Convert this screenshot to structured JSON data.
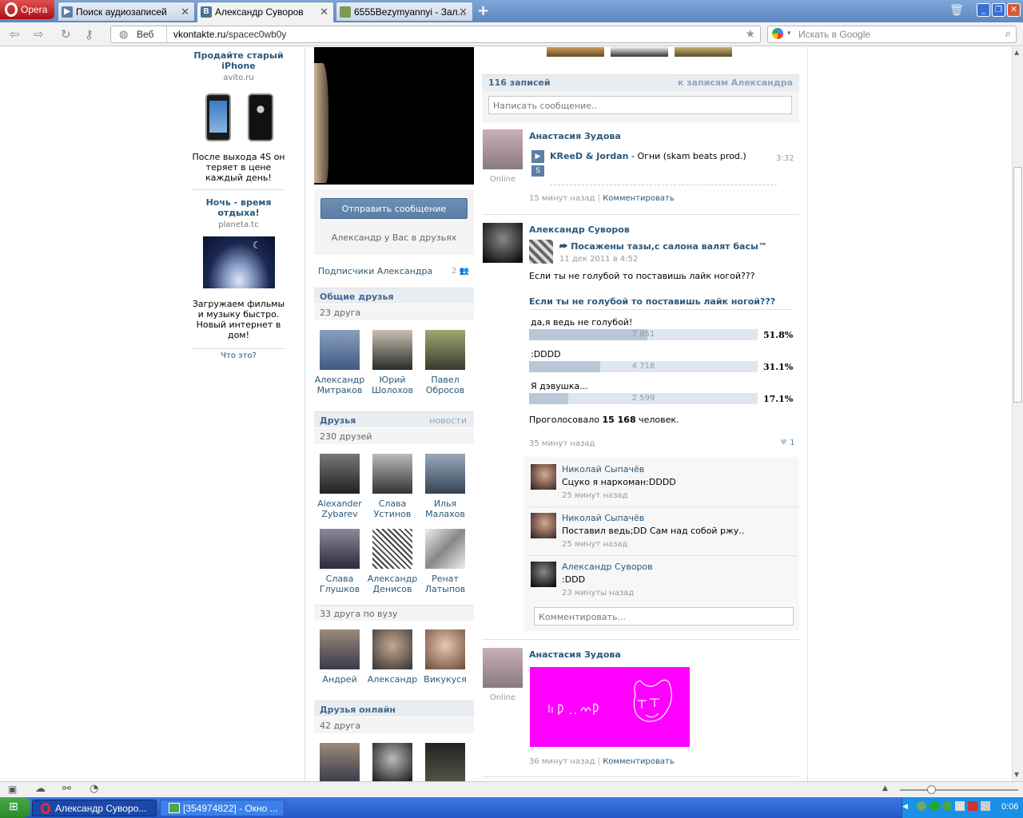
{
  "browser": {
    "menu_label": "Opera",
    "tabs": [
      {
        "label": "Поиск аудиозаписей"
      },
      {
        "label": "Александр Суворов"
      },
      {
        "label": "6555Bezymyannyi - Зал..."
      }
    ],
    "address_mode": "Веб",
    "url_host": "vkontakte.ru",
    "url_path": "/spacec0wb0y",
    "search_placeholder": "Искать в Google"
  },
  "ads": [
    {
      "title": "Продайте старый iPhone",
      "domain": "avito.ru",
      "text": "После выхода 4S он теряет в цене каждый день!"
    },
    {
      "title": "Ночь - время отдыха!",
      "domain": "planeta.tc",
      "text": "Загружаем фильмы и музыку быстро. Новый интернет в дом!"
    }
  ],
  "ads_what": "Что это?",
  "profile": {
    "send_message": "Отправить сообщение",
    "friend_status": "Александр у Вас в друзьях",
    "subscribers_label": "Подписчики Александра",
    "subscribers_count": "2",
    "common_friends": {
      "title": "Общие друзья",
      "count": "23 друга",
      "items": [
        {
          "first": "Александр",
          "last": "Митраков"
        },
        {
          "first": "Юрий",
          "last": "Шолохов"
        },
        {
          "first": "Павел",
          "last": "Обросов"
        }
      ]
    },
    "friends": {
      "title": "Друзья",
      "news": "новости",
      "count": "230 друзей",
      "items": [
        {
          "first": "Alexander",
          "last": "Zybarev"
        },
        {
          "first": "Слава",
          "last": "Устинов"
        },
        {
          "first": "Илья",
          "last": "Малахов"
        },
        {
          "first": "Слава",
          "last": "Глушков"
        },
        {
          "first": "Александр",
          "last": "Денисов"
        },
        {
          "first": "Ренат",
          "last": "Латыпов"
        }
      ]
    },
    "uni_friends": {
      "count": "33 друга по вузу",
      "items": [
        {
          "first": "Андрей",
          "last": ""
        },
        {
          "first": "Александр",
          "last": ""
        },
        {
          "first": "Викукуся",
          "last": ""
        }
      ]
    },
    "online_friends": {
      "title": "Друзья онлайн",
      "count": "42 друга"
    }
  },
  "wall": {
    "count": "116 записей",
    "to_posts": "к записям Александра",
    "input_placeholder": "Написать сообщение..",
    "post1": {
      "author": "Анастасия Зудова",
      "online": "Online",
      "artist": "KReeD & Jordan",
      "title": " - Огни (skam beats prod.)",
      "duration": "3:32",
      "time": "15 минут назад",
      "comment": "Комментировать"
    },
    "post2": {
      "author": "Александр Суворов",
      "repost_title": "Посажены тазы,с салона валят басы™",
      "repost_date": "11 дек 2011 в 4:52",
      "text": "Если ты не голубой то поставишь лайк ногой???",
      "poll_title": "Если ты не голубой то поставишь лайк ногой???",
      "poll": [
        {
          "label": "да,я ведь не голубой!",
          "votes": "7 851",
          "pct": "51.8%",
          "fraction": 0.518
        },
        {
          "label": ":DDDD",
          "votes": "4 718",
          "pct": "31.1%",
          "fraction": 0.311
        },
        {
          "label": "Я дэвушка...",
          "votes": "2 599",
          "pct": "17.1%",
          "fraction": 0.171
        }
      ],
      "voted_prefix": "Проголосовало ",
      "voted_count": "15 168",
      "voted_suffix": " человек.",
      "time": "35 минут назад",
      "likes": "1",
      "replies": [
        {
          "author": "Николай Сыпачёв",
          "text": "Сцуко я наркоман:DDDD",
          "time": "25 минут назад"
        },
        {
          "author": "Николай Сыпачёв",
          "text": "Поставил ведь;DD Сам над собой ржу..",
          "time": "25 минут назад"
        },
        {
          "author": "Александр Суворов",
          "text": ":DDD",
          "time": "23 минуты назад"
        }
      ],
      "comment_placeholder": "Комментировать..."
    },
    "post3": {
      "author": "Анастасия Зудова",
      "online": "Online",
      "time": "36 минут назад",
      "comment": "Комментировать"
    }
  },
  "taskbar": {
    "tasks": [
      {
        "label": "Александр Суворо..."
      },
      {
        "label": "[354974822] - Окно ..."
      }
    ],
    "clock": "0:06"
  },
  "colors": {
    "link": "#2b587a",
    "header_bg": "#e9edf1",
    "button": "#5b7fa6",
    "drawing_bg": "#ff00ff"
  }
}
